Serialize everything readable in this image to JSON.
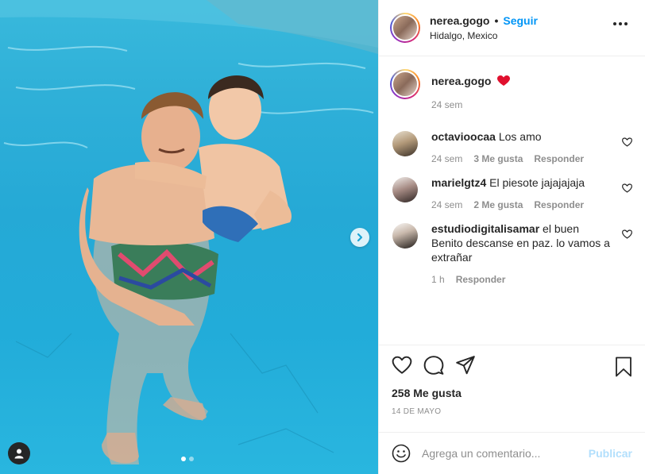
{
  "post": {
    "username": "nerea.gogo",
    "separator": "•",
    "follow_label": "Seguir",
    "location": "Hidalgo, Mexico"
  },
  "caption": {
    "username": "nerea.gogo",
    "emoji": "❤️",
    "time": "24 sem"
  },
  "comments": [
    {
      "username": "octavioocaa",
      "text": "Los amo",
      "time": "24 sem",
      "likes": "3 Me gusta",
      "reply": "Responder"
    },
    {
      "username": "marielgtz4",
      "text": "El piesote jajajajaja",
      "time": "24 sem",
      "likes": "2 Me gusta",
      "reply": "Responder"
    },
    {
      "username": "estudiodigitalisamar",
      "text": "el buen Benito descanse en paz. lo vamos a extrañar",
      "time": "1 h",
      "reply": "Responder"
    }
  ],
  "actions": {
    "likes": "258 Me gusta",
    "date": "14 DE MAYO"
  },
  "comment_box": {
    "placeholder": "Agrega un comentario...",
    "post_label": "Publicar"
  },
  "carousel": {
    "current": 1,
    "total": 2
  },
  "colors": {
    "accent": "#0095f6",
    "like_heart": "#ed4956",
    "publish_disabled": "#b2dffc"
  }
}
